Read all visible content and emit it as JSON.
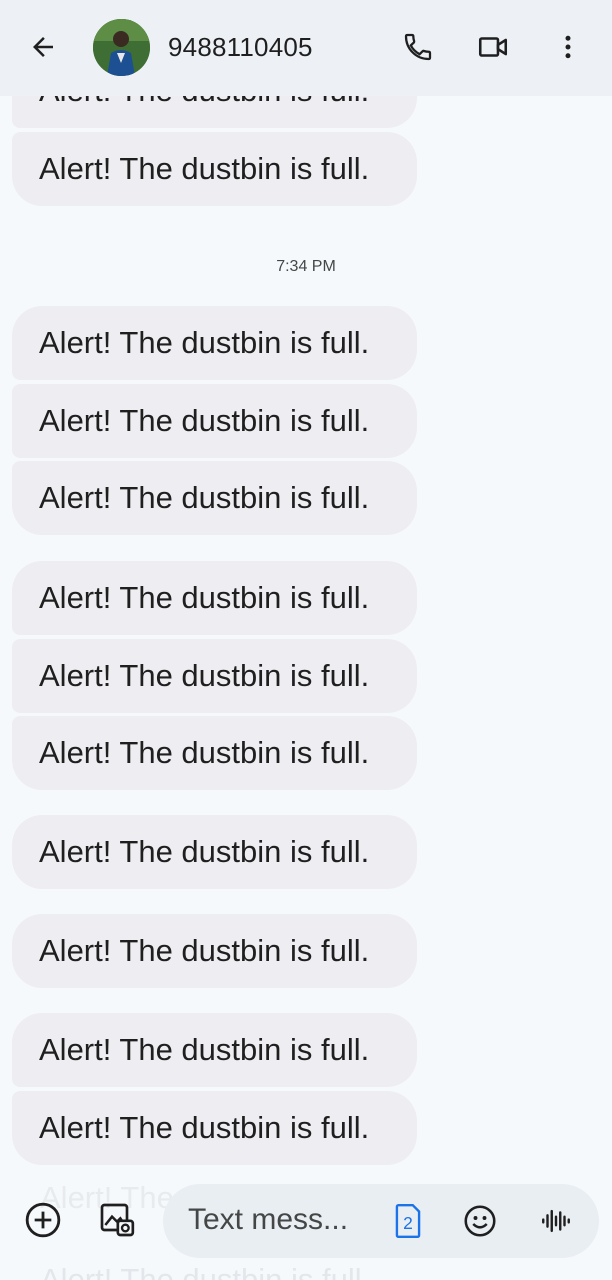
{
  "header": {
    "contact": "9488110405"
  },
  "thread": {
    "timestamp": "7:34 PM",
    "messages": [
      "Alert! The dustbin is full.",
      "Alert! The dustbin is full.",
      "Alert! The dustbin is full.",
      "Alert! The dustbin is full.",
      "Alert! The dustbin is full.",
      "Alert! The dustbin is full.",
      "Alert! The dustbin is full.",
      "Alert! The dustbin is full.",
      "Alert! The dustbin is full.",
      "Alert! The dustbin is full.",
      "Alert! The dustbin is full.",
      "Alert! The dustbin is full."
    ]
  },
  "compose": {
    "placeholder": "Text mess...",
    "sim_number": "2"
  },
  "colors": {
    "bubble": "#eeeef2",
    "background": "#f6f9fc",
    "topbar": "#edf1f5",
    "accent": "#1a73e8"
  },
  "icons": {
    "back": "arrow-left-icon",
    "call": "phone-icon",
    "video": "video-camera-icon",
    "more": "more-vertical-icon",
    "add": "add-circle-icon",
    "gallery": "gallery-icon",
    "sim": "sim-card-icon",
    "emoji": "emoji-icon",
    "voice": "voice-waveform-icon"
  }
}
